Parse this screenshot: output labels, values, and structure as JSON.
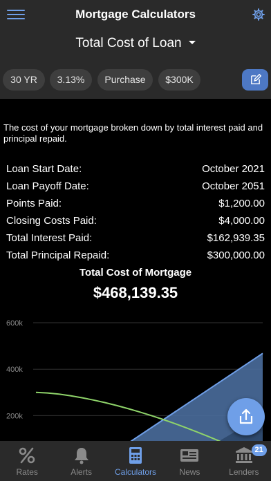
{
  "app": {
    "title": "Mortgage Calculators"
  },
  "selector": {
    "label": "Total Cost of Loan"
  },
  "chips": [
    {
      "label": "30 YR"
    },
    {
      "label": "3.13%"
    },
    {
      "label": "Purchase"
    },
    {
      "label": "$300K"
    }
  ],
  "description": "The cost of your mortgage broken down by total interest paid and principal repaid.",
  "rows": [
    {
      "label": "Loan Start Date:",
      "value": "October 2021"
    },
    {
      "label": "Loan Payoff Date:",
      "value": "October 2051"
    },
    {
      "label": "Points Paid:",
      "value": "$1,200.00"
    },
    {
      "label": "Closing Costs Paid:",
      "value": "$4,000.00"
    },
    {
      "label": "Total Interest Paid:",
      "value": "$162,939.35"
    },
    {
      "label": "Total Principal Repaid:",
      "value": "$300,000.00"
    }
  ],
  "summary": {
    "title": "Total Cost of Mortgage",
    "value": "$468,139.35"
  },
  "chart_data": {
    "type": "area",
    "title": "",
    "xlabel": "",
    "ylabel": "",
    "ylim": [
      0,
      600000
    ],
    "y_ticks": [
      "600k",
      "400k",
      "200k"
    ],
    "grid": true,
    "note": "partially visible, clipped at bottom",
    "series": [
      {
        "values": [
          0,
          468139
        ],
        "color": "#6f9fe8"
      },
      {
        "values": [
          300000,
          0
        ],
        "color": "#8fd46a"
      }
    ]
  },
  "colors": {
    "accent": "#6f9fe8",
    "bar": "#2a2a2a",
    "chip": "#3e3e3e"
  },
  "tabs": [
    {
      "label": "Rates",
      "icon": "percent-icon"
    },
    {
      "label": "Alerts",
      "icon": "bell-icon"
    },
    {
      "label": "Calculators",
      "icon": "calculator-icon",
      "active": true
    },
    {
      "label": "News",
      "icon": "newspaper-icon"
    },
    {
      "label": "Lenders",
      "icon": "bank-icon",
      "badge": "21"
    }
  ]
}
